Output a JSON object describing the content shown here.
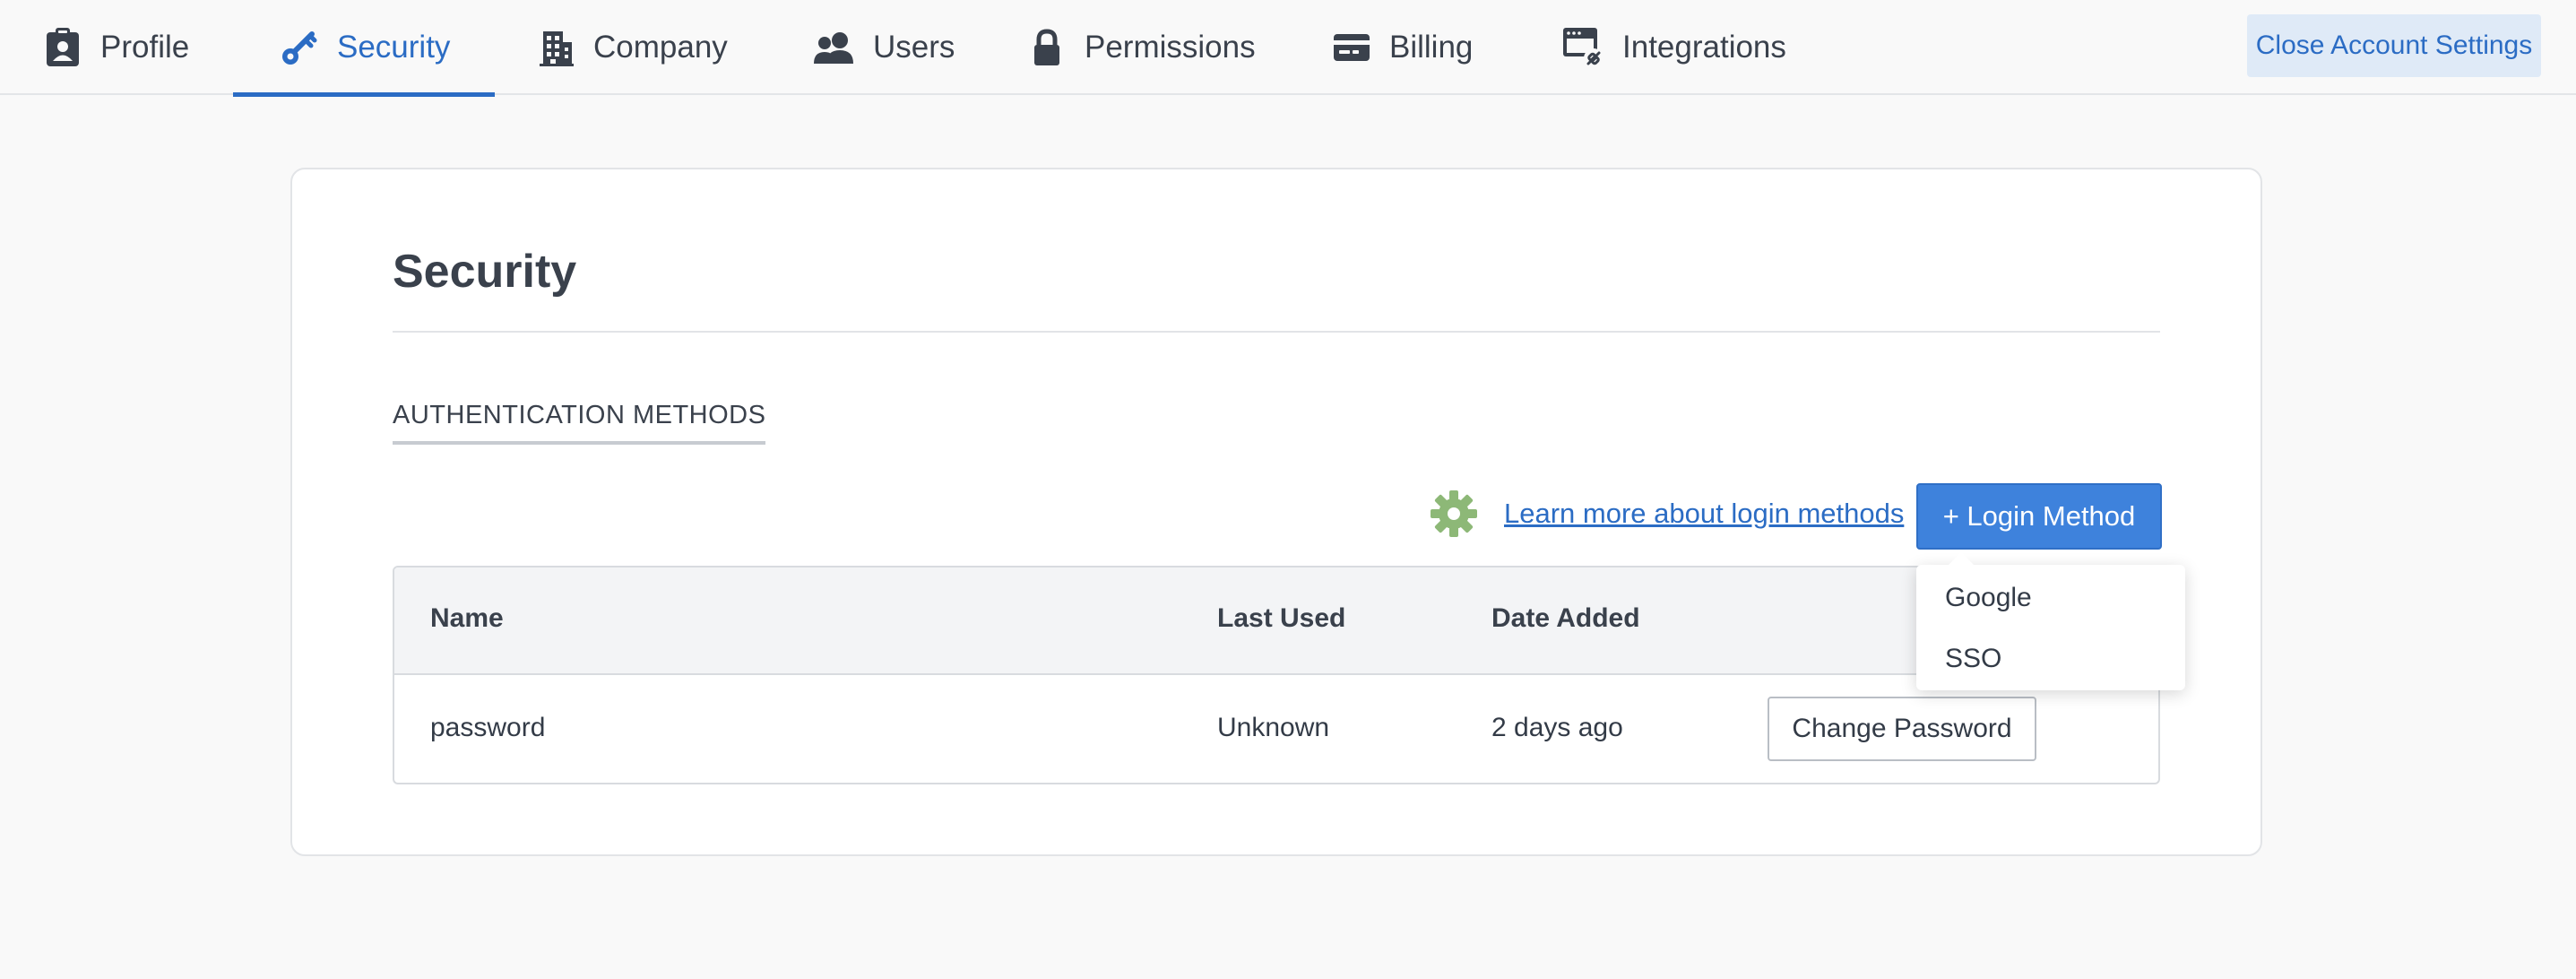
{
  "nav": {
    "tabs": [
      {
        "label": "Profile",
        "icon": "clipboard-user-icon"
      },
      {
        "label": "Security",
        "icon": "key-icon",
        "active": true
      },
      {
        "label": "Company",
        "icon": "building-icon"
      },
      {
        "label": "Users",
        "icon": "users-icon"
      },
      {
        "label": "Permissions",
        "icon": "lock-icon"
      },
      {
        "label": "Billing",
        "icon": "credit-card-icon"
      },
      {
        "label": "Integrations",
        "icon": "integration-window-icon"
      }
    ],
    "close_label": "Close Account Settings"
  },
  "page": {
    "title": "Security",
    "section_label": "AUTHENTICATION METHODS",
    "learn_link": "Learn more about login methods",
    "add_button": "+ Login Method"
  },
  "table": {
    "headers": [
      "Name",
      "Last Used",
      "Date Added"
    ],
    "rows": [
      {
        "name": "password",
        "last_used": "Unknown",
        "date_added": "2 days ago",
        "action": "Change Password"
      }
    ]
  },
  "dropdown": {
    "items": [
      "Google",
      "SSO"
    ]
  },
  "colors": {
    "accent": "#2b6cc4",
    "primary_button": "#3e82dc",
    "gear": "#8db877",
    "text": "#3a414c"
  }
}
